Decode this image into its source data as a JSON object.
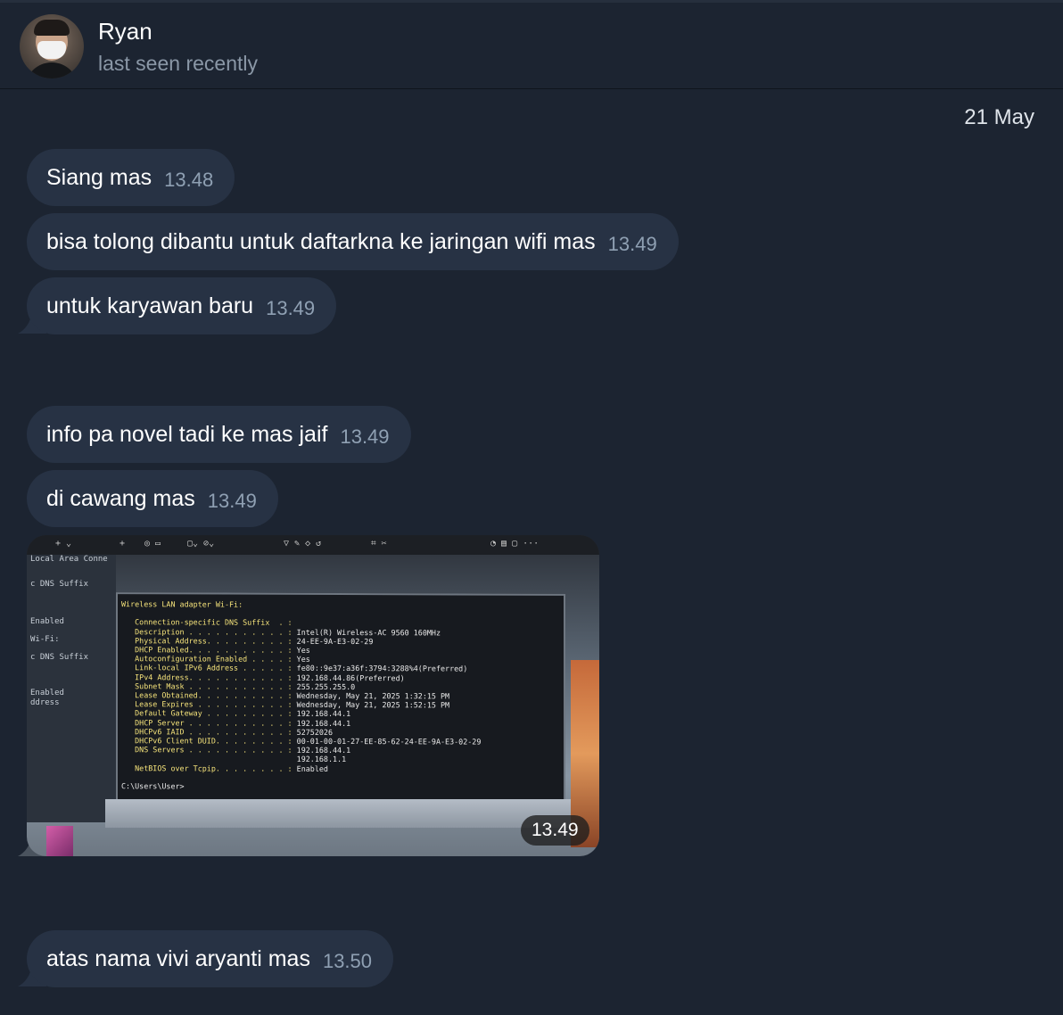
{
  "header": {
    "name": "Ryan",
    "status": "last seen recently"
  },
  "date_separator": "21 May",
  "messages": [
    {
      "text": "Siang mas",
      "time": "13.48"
    },
    {
      "text": "bisa tolong dibantu untuk daftarkna ke jaringan wifi mas",
      "time": "13.49"
    },
    {
      "text": "untuk karyawan baru",
      "time": "13.49"
    },
    {
      "text": "info pa novel tadi ke mas jaif",
      "time": "13.49"
    },
    {
      "text": "di cawang mas",
      "time": "13.49"
    },
    {
      "text": "atas nama vivi aryanti mas",
      "time": "13.50"
    }
  ],
  "photo_message": {
    "time": "13.49",
    "sidebar_lines": [
      "Local Area Conne",
      "c DNS Suffix",
      "Enabled",
      "Wi-Fi:",
      "c DNS Suffix",
      "Enabled",
      "ddress"
    ],
    "terminal": {
      "title": "Wireless LAN adapter Wi-Fi:",
      "rows": [
        [
          "Connection-specific DNS Suffix  . :",
          ""
        ],
        [
          "Description . . . . . . . . . . . :",
          "Intel(R) Wireless-AC 9560 160MHz"
        ],
        [
          "Physical Address. . . . . . . . . :",
          "24-EE-9A-E3-02-29"
        ],
        [
          "DHCP Enabled. . . . . . . . . . . :",
          "Yes"
        ],
        [
          "Autoconfiguration Enabled . . . . :",
          "Yes"
        ],
        [
          "Link-local IPv6 Address . . . . . :",
          "fe80::9e37:a36f:3794:3288%4(Preferred)"
        ],
        [
          "IPv4 Address. . . . . . . . . . . :",
          "192.168.44.86(Preferred)"
        ],
        [
          "Subnet Mask . . . . . . . . . . . :",
          "255.255.255.0"
        ],
        [
          "Lease Obtained. . . . . . . . . . :",
          "Wednesday, May 21, 2025 1:32:15 PM"
        ],
        [
          "Lease Expires . . . . . . . . . . :",
          "Wednesday, May 21, 2025 1:52:15 PM"
        ],
        [
          "Default Gateway . . . . . . . . . :",
          "192.168.44.1"
        ],
        [
          "DHCP Server . . . . . . . . . . . :",
          "192.168.44.1"
        ],
        [
          "DHCPv6 IAID . . . . . . . . . . . :",
          "52752026"
        ],
        [
          "DHCPv6 Client DUID. . . . . . . . :",
          "00-01-00-01-27-EE-85-62-24-EE-9A-E3-02-29"
        ],
        [
          "DNS Servers . . . . . . . . . . . :",
          "192.168.44.1"
        ],
        [
          "",
          "192.168.1.1"
        ],
        [
          "NetBIOS over Tcpip. . . . . . . . :",
          "Enabled"
        ]
      ],
      "prompt": "C:\\Users\\User>"
    }
  },
  "colors": {
    "background": "#1c2431",
    "bubble": "#273244",
    "time_text": "#8fa0b3",
    "status_text": "#8a97a6"
  }
}
